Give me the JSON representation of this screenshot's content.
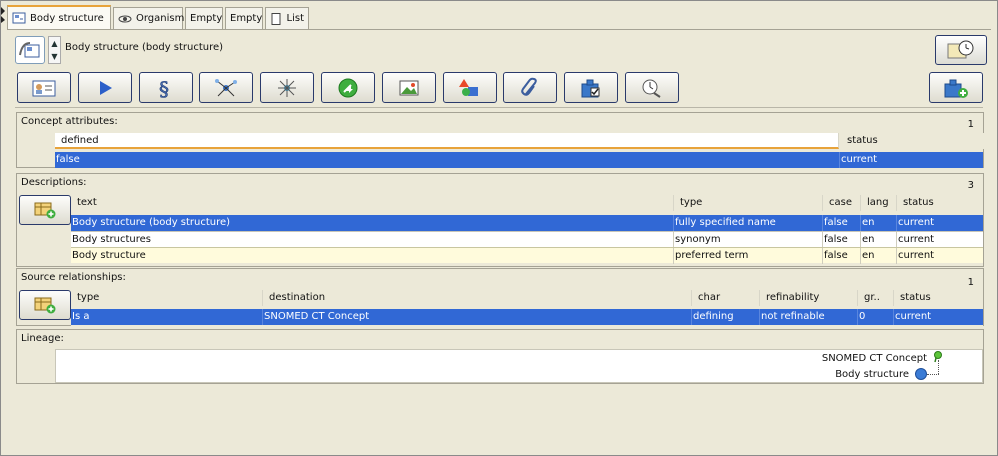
{
  "tabs": [
    {
      "label": "Body structure",
      "icon": "concept-tab-icon",
      "active": true
    },
    {
      "label": "Organism",
      "icon": "eye-icon",
      "active": false
    },
    {
      "label": "Empty",
      "icon": "",
      "active": false
    },
    {
      "label": "Empty",
      "icon": "",
      "active": false
    },
    {
      "label": "List",
      "icon": "document-icon",
      "active": false
    }
  ],
  "header": {
    "concept_title": "Body structure (body structure)",
    "spinner_up": "▲",
    "spinner_down": "▼"
  },
  "concept_attributes": {
    "title": "Concept attributes:",
    "count": "1",
    "columns": [
      "defined",
      "status"
    ],
    "rows": [
      [
        "false",
        "current"
      ]
    ]
  },
  "descriptions": {
    "title": "Descriptions:",
    "count": "3",
    "columns": [
      "text",
      "type",
      "case",
      "lang",
      "status"
    ],
    "rows": [
      [
        "Body structure (body structure)",
        "fully specified name",
        "false",
        "en",
        "current"
      ],
      [
        "Body structures",
        "synonym",
        "false",
        "en",
        "current"
      ],
      [
        "Body structure",
        "preferred term",
        "false",
        "en",
        "current"
      ]
    ]
  },
  "source_relationships": {
    "title": "Source relationships:",
    "count": "1",
    "columns": [
      "type",
      "destination",
      "char",
      "refinability",
      "gr..",
      "status"
    ],
    "rows": [
      [
        "Is a",
        "SNOMED CT Concept",
        "defining",
        "not refinable",
        "0",
        "current"
      ]
    ]
  },
  "lineage": {
    "title": "Lineage:",
    "parent": "SNOMED CT Concept",
    "child": "Body structure"
  },
  "colors": {
    "selection": "#3168d5",
    "tab_accent": "#e8a33a",
    "preferred_row": "#fffbdc"
  }
}
